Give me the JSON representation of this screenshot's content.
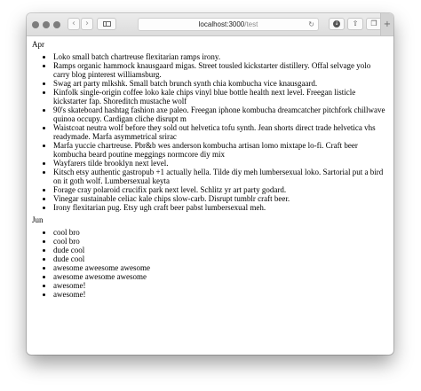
{
  "browser": {
    "url_host": "localhost:3000",
    "url_path": "/test",
    "nav_back_glyph": "‹",
    "nav_forward_glyph": "›",
    "reload_glyph": "↻",
    "new_tab_glyph": "+",
    "icons": [
      "close-traffic-icon",
      "minimize-traffic-icon",
      "zoom-traffic-icon",
      "back-arrow-icon",
      "forward-arrow-icon",
      "sidebar-icon",
      "reload-icon",
      "downloads-icon",
      "share-icon",
      "tabs-overview-icon",
      "new-tab-icon"
    ]
  },
  "sections": [
    {
      "heading": "Apr",
      "items": [
        "Loko small batch chartreuse flexitarian ramps irony.",
        "Ramps organic hammock knausgaard migas. Street tousled kickstarter distillery. Offal selvage yolo carry blog pinterest williamsburg.",
        "Swag art party mlkshk. Small batch brunch synth chia kombucha vice knausgaard.",
        "Kinfolk single-origin coffee loko kale chips vinyl blue bottle health next level. Freegan listicle kickstarter fap. Shoreditch mustache wolf",
        "90's skateboard hashtag fashion axe paleo. Freegan iphone kombucha dreamcatcher pitchfork chillwave quinoa occupy. Cardigan cliche disrupt m",
        "Waistcoat neutra wolf before they sold out helvetica tofu synth. Jean shorts direct trade helvetica vhs readymade. Marfa asymmetrical srirac",
        "Marfa yuccie chartreuse. Pbr&b wes anderson kombucha artisan lomo mixtape lo-fi. Craft beer kombucha beard poutine meggings normcore diy mix",
        "Wayfarers tilde brooklyn next level.",
        "Kitsch etsy authentic gastropub +1 actually hella. Tilde diy meh lumbersexual loko. Sartorial put a bird on it goth wolf. Lumbersexual keyta",
        "Forage cray polaroid crucifix park next level. Schlitz yr art party godard.",
        "Vinegar sustainable celiac kale chips slow-carb. Disrupt tumblr craft beer.",
        "Irony flexitarian pug. Etsy ugh craft beer pabst lumbersexual meh."
      ]
    },
    {
      "heading": "Jun",
      "items": [
        "cool bro",
        "cool bro",
        "dude cool",
        "dude cool",
        "awesome aweesome awesome",
        "awesome awesome awesome",
        "awesome!",
        "awesome!"
      ]
    }
  ]
}
